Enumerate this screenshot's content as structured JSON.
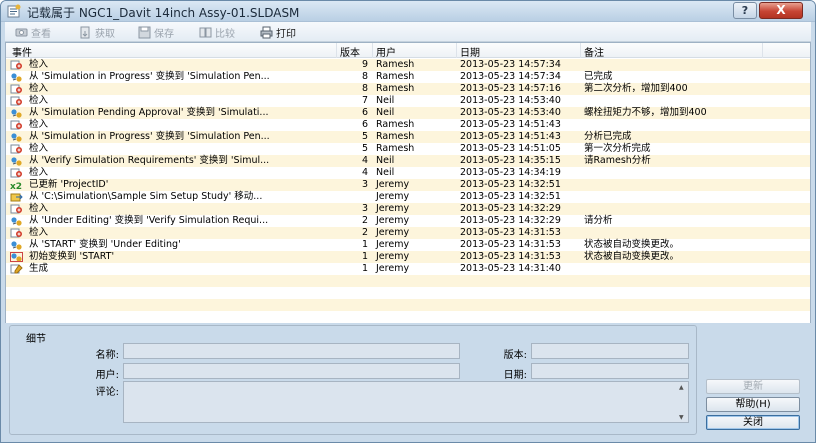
{
  "window": {
    "title": "记载属于 NGC1_Davit 14inch Assy-01.SLDASM",
    "help_button": "?",
    "close_button": "X"
  },
  "toolbar": {
    "view": "查看",
    "get": "获取",
    "save": "保存",
    "compare": "比较",
    "print": "打印"
  },
  "columns": {
    "event": "事件",
    "version": "版本",
    "user": "用户",
    "date": "日期",
    "note": "备注"
  },
  "rows": [
    {
      "icon": "checkin-icon",
      "event": "检入",
      "version": "9",
      "user": "Ramesh",
      "date": "2013-05-23 14:57:34",
      "note": ""
    },
    {
      "icon": "transition-icon",
      "event": "从 'Simulation in Progress' 变换到 'Simulation Pen...",
      "version": "8",
      "user": "Ramesh",
      "date": "2013-05-23 14:57:34",
      "note": "已完成"
    },
    {
      "icon": "checkin-icon",
      "event": "检入",
      "version": "8",
      "user": "Ramesh",
      "date": "2013-05-23 14:57:16",
      "note": "第二次分析，增加到400"
    },
    {
      "icon": "checkin-icon",
      "event": "检入",
      "version": "7",
      "user": "Neil",
      "date": "2013-05-23 14:53:40",
      "note": ""
    },
    {
      "icon": "transition-icon",
      "event": "从 'Simulation Pending Approval' 变换到 'Simulati...",
      "version": "6",
      "user": "Neil",
      "date": "2013-05-23 14:53:40",
      "note": "螺栓扭矩力不够，增加到400"
    },
    {
      "icon": "checkin-icon",
      "event": "检入",
      "version": "6",
      "user": "Ramesh",
      "date": "2013-05-23 14:51:43",
      "note": ""
    },
    {
      "icon": "transition-icon",
      "event": "从 'Simulation in Progress' 变换到 'Simulation Pen...",
      "version": "5",
      "user": "Ramesh",
      "date": "2013-05-23 14:51:43",
      "note": "分析已完成"
    },
    {
      "icon": "checkin-icon",
      "event": "检入",
      "version": "5",
      "user": "Ramesh",
      "date": "2013-05-23 14:51:05",
      "note": "第一次分析完成"
    },
    {
      "icon": "transition-icon",
      "event": "从 'Verify Simulation Requirements' 变换到 'Simul...",
      "version": "4",
      "user": "Neil",
      "date": "2013-05-23 14:35:15",
      "note": "请Ramesh分析"
    },
    {
      "icon": "checkin-icon",
      "event": "检入",
      "version": "4",
      "user": "Neil",
      "date": "2013-05-23 14:34:19",
      "note": ""
    },
    {
      "icon": "update-icon",
      "event": "已更新 'ProjectID'",
      "version": "3",
      "user": "Jeremy",
      "date": "2013-05-23 14:32:51",
      "note": ""
    },
    {
      "icon": "move-icon",
      "event": "从 'C:\\Simulation\\Sample Sim Setup Study' 移动...",
      "version": "",
      "user": "Jeremy",
      "date": "2013-05-23 14:32:51",
      "note": ""
    },
    {
      "icon": "checkin-icon",
      "event": "检入",
      "version": "3",
      "user": "Jeremy",
      "date": "2013-05-23 14:32:29",
      "note": ""
    },
    {
      "icon": "transition-icon",
      "event": "从 'Under Editing' 变换到 'Verify Simulation Requi...",
      "version": "2",
      "user": "Jeremy",
      "date": "2013-05-23 14:32:29",
      "note": "请分析"
    },
    {
      "icon": "checkin-icon",
      "event": "检入",
      "version": "2",
      "user": "Jeremy",
      "date": "2013-05-23 14:31:53",
      "note": ""
    },
    {
      "icon": "transition-icon",
      "event": "从 'START' 变换到 'Under Editing'",
      "version": "1",
      "user": "Jeremy",
      "date": "2013-05-23 14:31:53",
      "note": "状态被自动变换更改。"
    },
    {
      "icon": "initial-transition-icon",
      "event": "初始变换到 'START'",
      "version": "1",
      "user": "Jeremy",
      "date": "2013-05-23 14:31:53",
      "note": "状态被自动变换更改。"
    },
    {
      "icon": "create-icon",
      "event": "生成",
      "version": "1",
      "user": "Jeremy",
      "date": "2013-05-23 14:31:40",
      "note": ""
    }
  ],
  "details": {
    "legend": "细节",
    "name_label": "名称:",
    "version_label": "版本:",
    "user_label": "用户:",
    "date_label": "日期:",
    "comment_label": "评论:"
  },
  "buttons": {
    "refresh": "更新",
    "help": "帮助(H)",
    "close": "关闭"
  },
  "colors": {
    "row_alt": "#fdf5dc",
    "window_bg": "#c9daea",
    "close_red": "#c74534"
  }
}
